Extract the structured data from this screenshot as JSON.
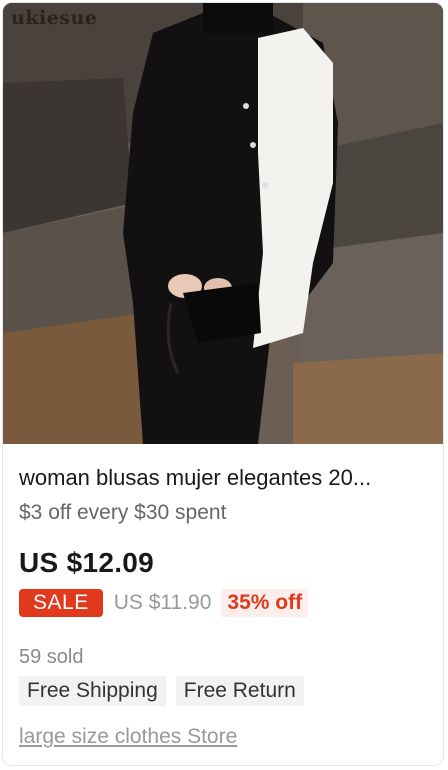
{
  "product": {
    "image": {
      "watermark": "ukiesue",
      "icon": "product-photo"
    },
    "title": "woman blusas mujer elegantes 20...",
    "promo": "$3 off every $30 spent",
    "price": "US $12.09",
    "sale_badge": "SALE",
    "original_price": "US $11.90",
    "discount": "35% off",
    "sold": "59 sold",
    "tags": [
      "Free Shipping",
      "Free Return"
    ],
    "store": "large size clothes Store"
  },
  "colors": {
    "accent": "#e0391c",
    "discount_bg": "#fdeeee",
    "tag_bg": "#f2f2f2"
  }
}
